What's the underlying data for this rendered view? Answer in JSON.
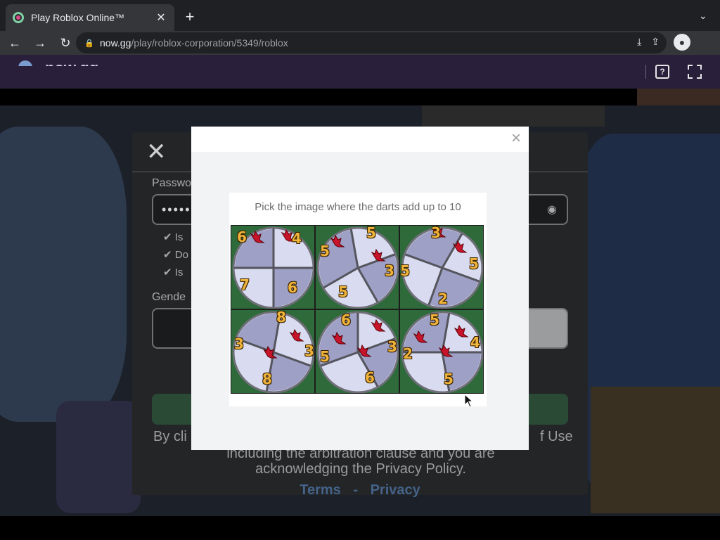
{
  "browser": {
    "tab_title": "Play Roblox Online™",
    "tab_close": "✕",
    "new_tab": "+",
    "tab_menu": "⌄",
    "url_host": "now.gg",
    "url_path": "/play/roblox-corporation/5349/roblox",
    "back_icon": "←",
    "forward_icon": "→",
    "reload_icon": "↻"
  },
  "site": {
    "logo_text": "now.gg",
    "help_label": "?"
  },
  "signup": {
    "close_label": "✕",
    "password_label": "Passwo",
    "password_value": "•••••",
    "checks": [
      "Is",
      "Do",
      "Is"
    ],
    "gender_label": "Gende",
    "terms_left": "By cli",
    "terms_right": "f Use",
    "terms_line2": "including the arbitration clause and you are",
    "terms_line3": "acknowledging the Privacy Policy.",
    "link_terms": "Terms",
    "link_sep": "-",
    "link_privacy": "Privacy"
  },
  "modal": {
    "close_label": "×",
    "prompt": "Pick the image where the darts add up to 10",
    "tiles": [
      {
        "numbers": [
          "6",
          "4",
          "7",
          "6"
        ]
      },
      {
        "numbers": [
          "5",
          "5",
          "3",
          "5"
        ]
      },
      {
        "numbers": [
          "3",
          "5",
          "5",
          "2"
        ]
      },
      {
        "numbers": [
          "8",
          "3",
          "3",
          "8"
        ]
      },
      {
        "numbers": [
          "6",
          "3",
          "5",
          "6"
        ]
      },
      {
        "numbers": [
          "5",
          "4",
          "2",
          "5"
        ]
      }
    ]
  }
}
